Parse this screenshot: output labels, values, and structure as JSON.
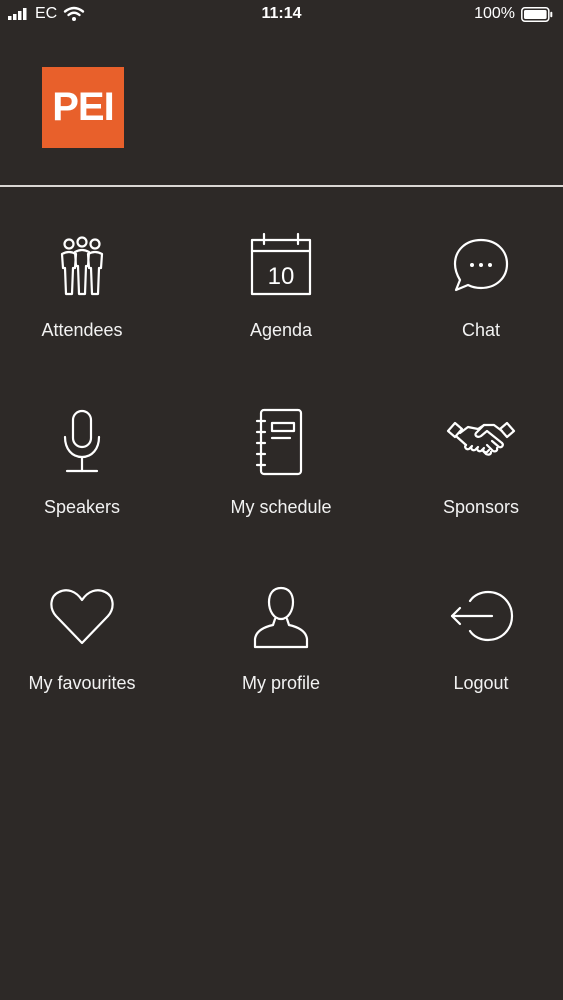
{
  "status_bar": {
    "carrier": "EC",
    "time": "11:14",
    "battery_percent": "100%"
  },
  "header": {
    "logo_text": "PEI"
  },
  "menu": {
    "items": [
      {
        "label": "Attendees",
        "icon": "attendees-icon"
      },
      {
        "label": "Agenda",
        "icon": "calendar-icon",
        "calendar_day": "10"
      },
      {
        "label": "Chat",
        "icon": "chat-bubble-icon"
      },
      {
        "label": "Speakers",
        "icon": "microphone-icon"
      },
      {
        "label": "My schedule",
        "icon": "notebook-icon"
      },
      {
        "label": "Sponsors",
        "icon": "handshake-icon"
      },
      {
        "label": "My favourites",
        "icon": "heart-icon"
      },
      {
        "label": "My profile",
        "icon": "user-icon"
      },
      {
        "label": "Logout",
        "icon": "logout-icon"
      }
    ]
  },
  "colors": {
    "background": "#2d2927",
    "logo": "#e8602b",
    "text": "#ffffff"
  }
}
